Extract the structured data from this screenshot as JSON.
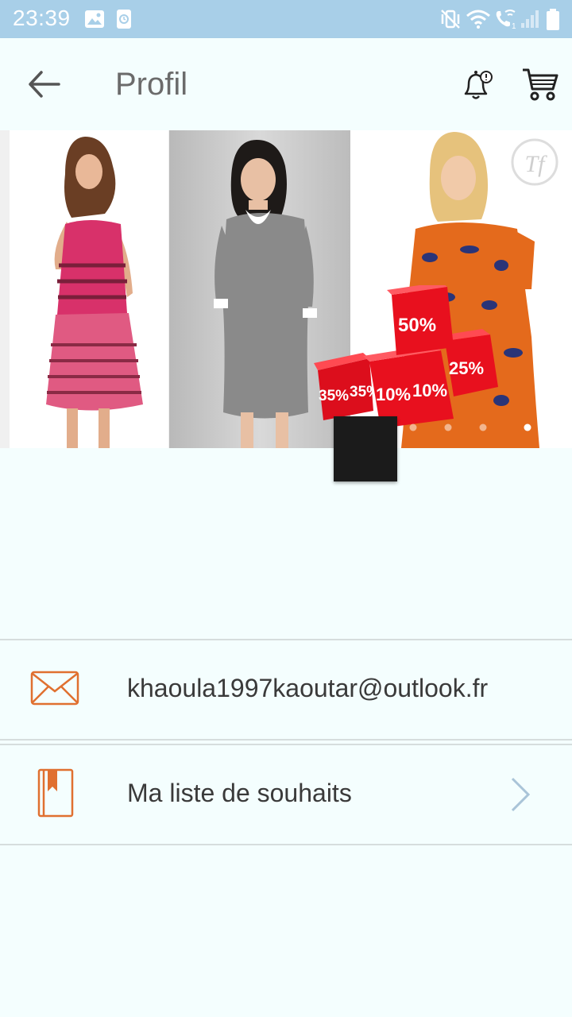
{
  "status_bar": {
    "time": "23:39",
    "icons": [
      "image-icon",
      "clock-app-icon",
      "mute-vibrate-icon",
      "wifi-icon",
      "wifi-calling-icon",
      "signal-icon",
      "battery-icon"
    ]
  },
  "app_bar": {
    "title": "Profil",
    "icons": [
      "back-arrow-icon",
      "notification-bell-icon",
      "cart-icon"
    ]
  },
  "banner": {
    "logo_text": "Tf",
    "discount_labels": [
      "50%",
      "25%",
      "35%",
      "35%",
      "10%",
      "10%"
    ],
    "page_indicator": {
      "total": 5,
      "active": 4
    }
  },
  "profile": {
    "email": "khaoula1997kaoutar@outlook.fr",
    "wishlist_label": "Ma liste de souhaits"
  },
  "colors": {
    "status_bar": "#a8cfe8",
    "background": "#f4fefe",
    "accent_icon": "#e07030",
    "chevron": "#a9c4d8",
    "sale_red": "#e8101e"
  }
}
